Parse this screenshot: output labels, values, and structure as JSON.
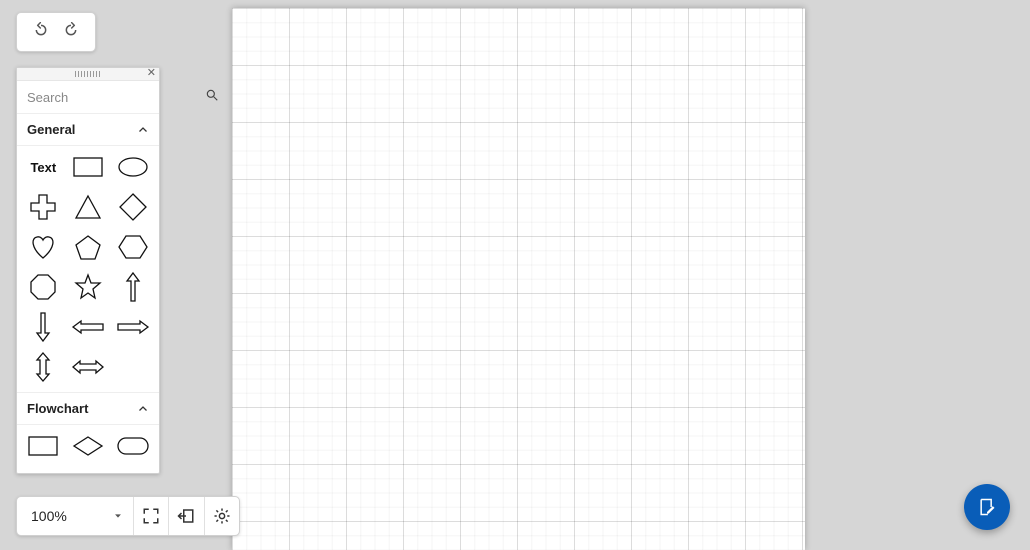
{
  "toolbar": {
    "zoom": "100%"
  },
  "search": {
    "placeholder": "Search",
    "value": ""
  },
  "sections": {
    "general": {
      "title": "General",
      "text_label": "Text"
    },
    "flowchart": {
      "title": "Flowchart"
    }
  }
}
